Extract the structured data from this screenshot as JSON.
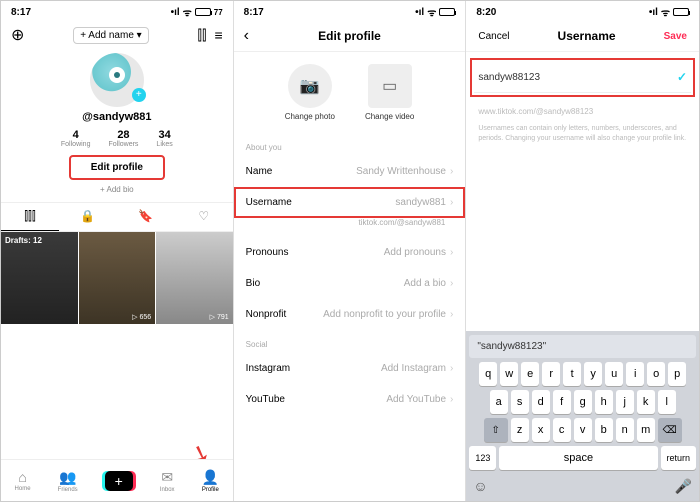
{
  "panel1": {
    "time": "8:17",
    "battery": "77",
    "add_name": "+ Add name ▾",
    "handle": "@sandyw881",
    "stats": [
      {
        "n": "4",
        "l": "Following"
      },
      {
        "n": "28",
        "l": "Followers"
      },
      {
        "n": "34",
        "l": "Likes"
      }
    ],
    "edit_profile": "Edit profile",
    "add_bio": "+ Add bio",
    "thumbs": {
      "drafts": "Drafts: 12",
      "v1": "▷ 656",
      "v2": "▷ 791"
    },
    "nav": {
      "home": "Home",
      "friends": "Friends",
      "inbox": "Inbox",
      "profile": "Profile"
    }
  },
  "panel2": {
    "time": "8:17",
    "title": "Edit profile",
    "change_photo": "Change photo",
    "change_video": "Change video",
    "about_you": "About you",
    "rows": {
      "name_k": "Name",
      "name_v": "Sandy Writtenhouse",
      "user_k": "Username",
      "user_v": "sandyw881",
      "url": "tiktok.com/@sandyw881",
      "pron_k": "Pronouns",
      "pron_v": "Add pronouns",
      "bio_k": "Bio",
      "bio_v": "Add a bio",
      "np_k": "Nonprofit",
      "np_v": "Add nonprofit to your profile"
    },
    "social": "Social",
    "ig_k": "Instagram",
    "ig_v": "Add Instagram",
    "yt_k": "YouTube",
    "yt_v": "Add YouTube"
  },
  "panel3": {
    "time": "8:20",
    "cancel": "Cancel",
    "title": "Username",
    "save": "Save",
    "value": "sandyw88123",
    "url": "www.tiktok.com/@sandyw88123",
    "note": "Usernames can contain only letters, numbers, underscores, and periods. Changing your username will also change your profile link.",
    "suggest": "\"sandyw88123\"",
    "keys": {
      "r1": [
        "q",
        "w",
        "e",
        "r",
        "t",
        "y",
        "u",
        "i",
        "o",
        "p"
      ],
      "r2": [
        "a",
        "s",
        "d",
        "f",
        "g",
        "h",
        "j",
        "k",
        "l"
      ],
      "r3": [
        "z",
        "x",
        "c",
        "v",
        "b",
        "n",
        "m"
      ],
      "num": "123",
      "space": "space",
      "return": "return"
    }
  }
}
